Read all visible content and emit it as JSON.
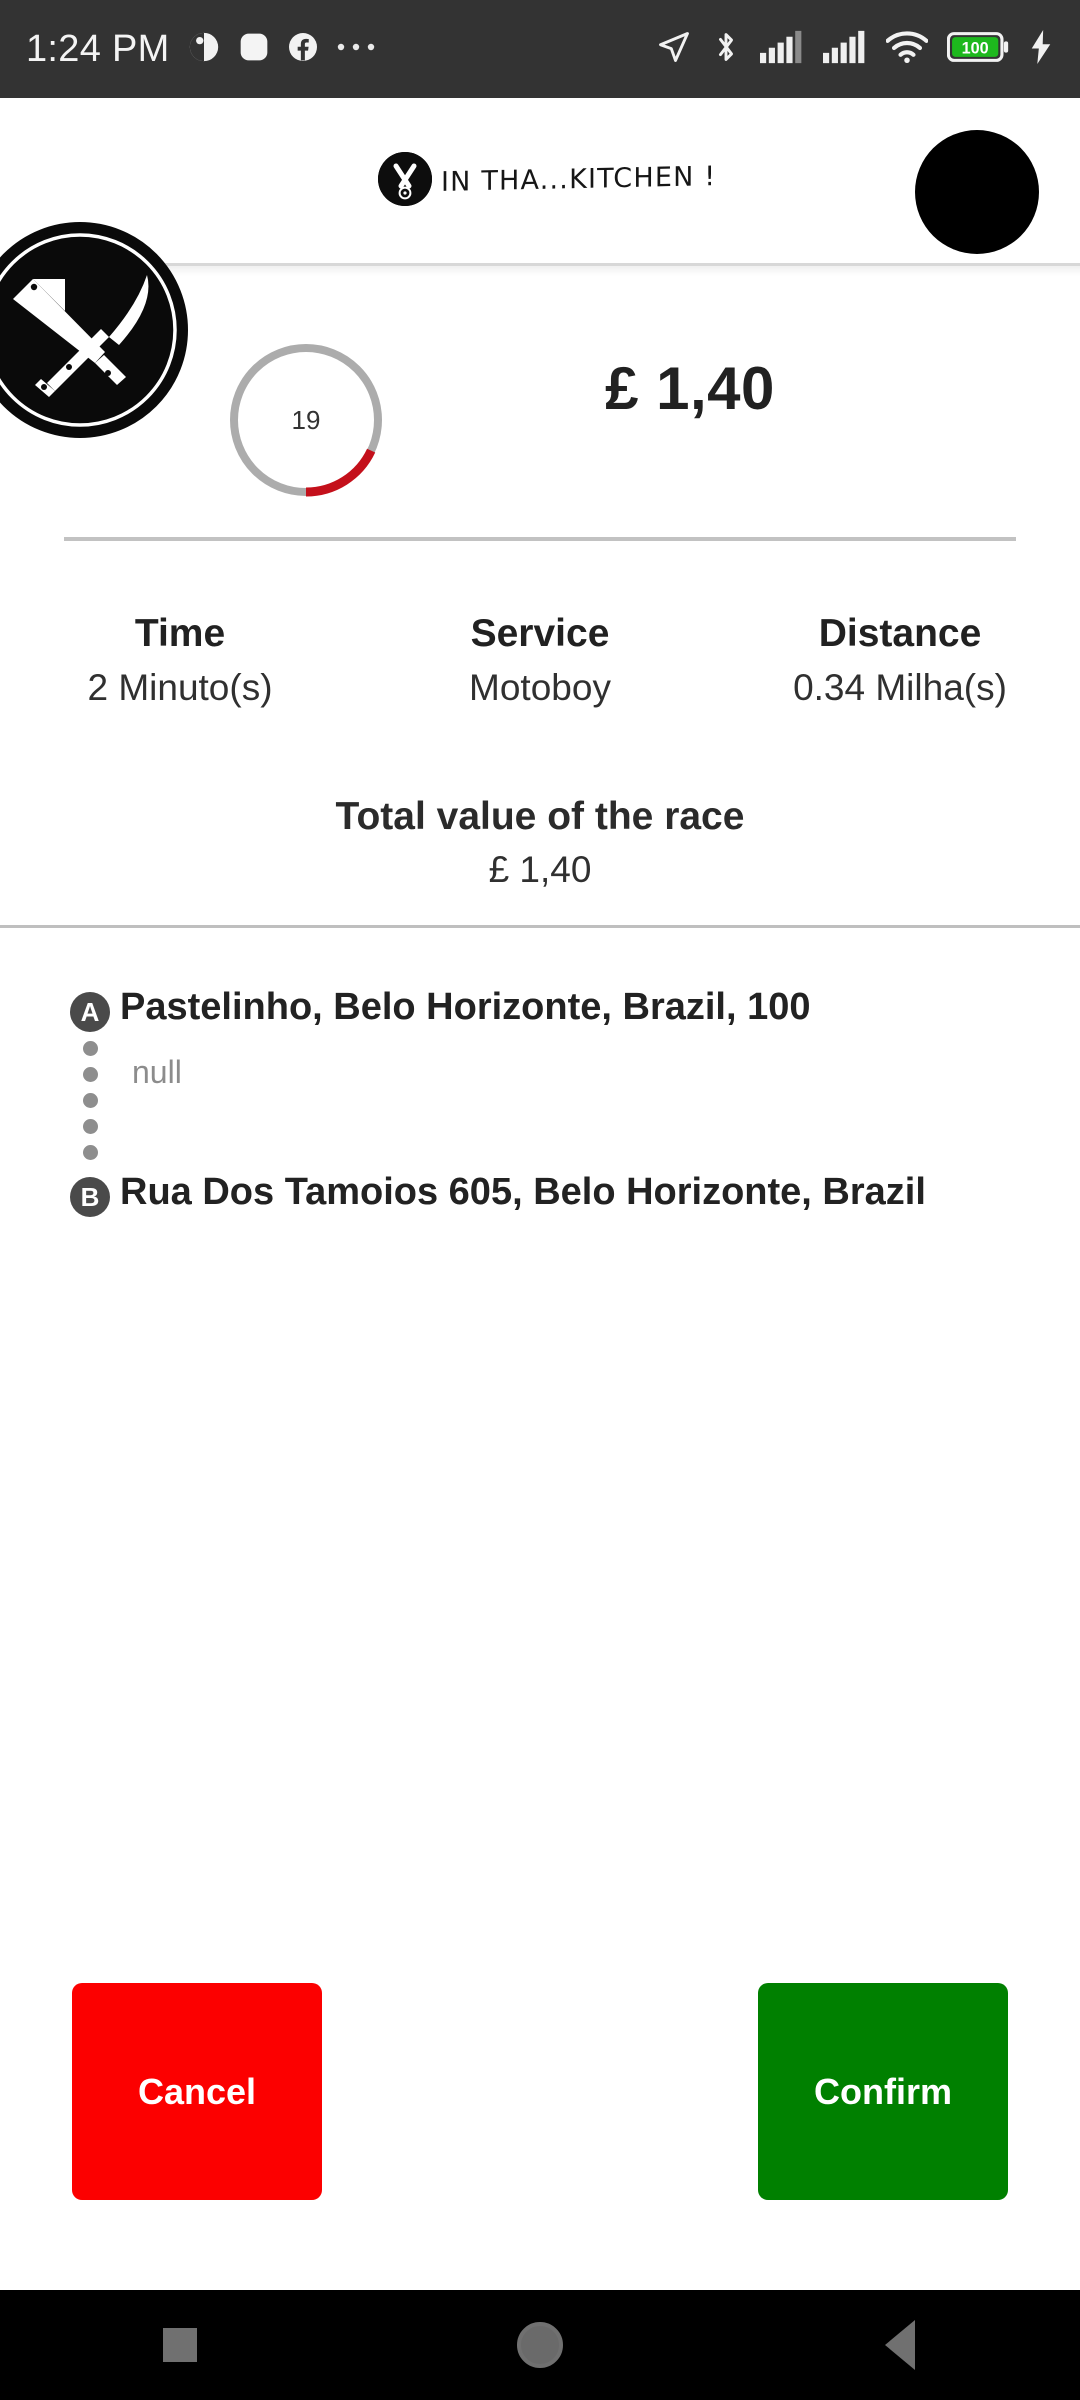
{
  "statusbar": {
    "time": "1:24 PM",
    "battery_level": "100",
    "icons_left": [
      "clock-notification-icon",
      "app-notification-icon",
      "facebook-icon",
      "more-notifications-icon"
    ],
    "icons_right": [
      "location-arrow-icon",
      "bluetooth-icon",
      "signal-sim1-icon",
      "signal-sim2-icon",
      "wifi-icon",
      "battery-icon",
      "charging-bolt-icon"
    ]
  },
  "header": {
    "brand_text": "IN THA...KITCHEN !",
    "brand_mark_icon": "crossed-knives-logo-icon",
    "avatar_icon": "user-avatar",
    "store_logo_icon": "crossed-cleaver-knife-logo"
  },
  "summary": {
    "countdown_seconds": "19",
    "countdown_progress_pct": 18,
    "ring_track_color": "#acacac",
    "ring_progress_color": "#c4101b",
    "price": "£ 1,40"
  },
  "stats": [
    {
      "label": "Time",
      "value": "2 Minuto(s)"
    },
    {
      "label": "Service",
      "value": "Motoboy"
    },
    {
      "label": "Distance",
      "value": "0.34 Milha(s)"
    }
  ],
  "total": {
    "label": "Total value of the race",
    "value": "£ 1,40"
  },
  "route": {
    "pickup_marker": "A",
    "pickup_address": "Pastelinho, Belo Horizonte, Brazil, 100",
    "pickup_note": "null",
    "dropoff_marker": "B",
    "dropoff_address": "Rua Dos Tamoios 605, Belo Horizonte, Brazil"
  },
  "actions": {
    "cancel_label": "Cancel",
    "cancel_color": "#fc0000",
    "confirm_label": "Confirm",
    "confirm_color": "#008000"
  },
  "navbar": {
    "recents_icon": "recents-square-icon",
    "home_icon": "home-circle-icon",
    "back_icon": "back-triangle-icon"
  }
}
